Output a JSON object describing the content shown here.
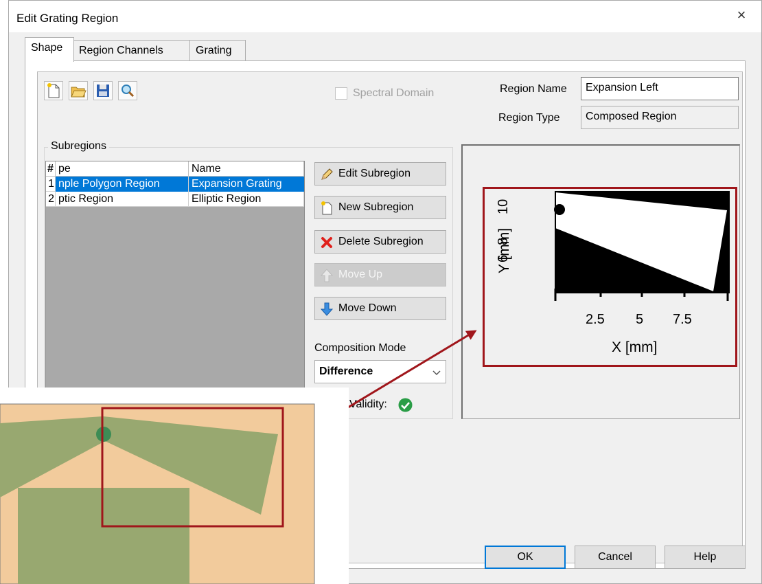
{
  "dialog": {
    "title": "Edit Grating Region",
    "close_glyph": "×"
  },
  "tabs": [
    {
      "label": "Shape",
      "active": true
    },
    {
      "label": "Region Channels",
      "active": false
    },
    {
      "label": "Grating",
      "active": false
    }
  ],
  "toolbar": {
    "icons": [
      "new-icon",
      "open-icon",
      "save-icon",
      "view-icon"
    ]
  },
  "spectral_domain": {
    "label": "Spectral Domain",
    "checked": false,
    "enabled": false
  },
  "region_name": {
    "label": "Region Name",
    "value": "Expansion Left"
  },
  "region_type": {
    "label": "Region Type",
    "value": "Composed Region"
  },
  "subregions": {
    "group_label": "Subregions",
    "columns": [
      "#",
      "pe",
      "Name"
    ],
    "rows": [
      {
        "num": "1",
        "type": "nple Polygon Region",
        "name": "Expansion Grating",
        "selected": true
      },
      {
        "num": "2",
        "type": "ptic Region",
        "name": "Elliptic Region",
        "selected": false
      }
    ]
  },
  "buttons": {
    "edit": "Edit Subregion",
    "new": "New Subregion",
    "delete": "Delete Subregion",
    "move_up": "Move Up",
    "move_down": "Move Down"
  },
  "composition": {
    "label": "Composition Mode",
    "value": "Difference"
  },
  "validity": {
    "label": "Validity:",
    "state": "valid"
  },
  "preview_plot": {
    "ylabel": "Y [mm]",
    "xlabel": "X [mm]",
    "yticks": [
      "6",
      "8",
      "10"
    ],
    "xticks": [
      "2.5",
      "5",
      "7.5"
    ]
  },
  "footer": {
    "ok": "OK",
    "cancel": "Cancel",
    "help": "Help"
  },
  "colors": {
    "accent": "#0078d7",
    "annotation": "#a0161b",
    "inset_bg": "#f2cb9c",
    "inset_shape": "#98a870",
    "inset_dot": "#3d8c55",
    "delete_red": "#e0201b",
    "valid_green": "#2a9d47"
  }
}
